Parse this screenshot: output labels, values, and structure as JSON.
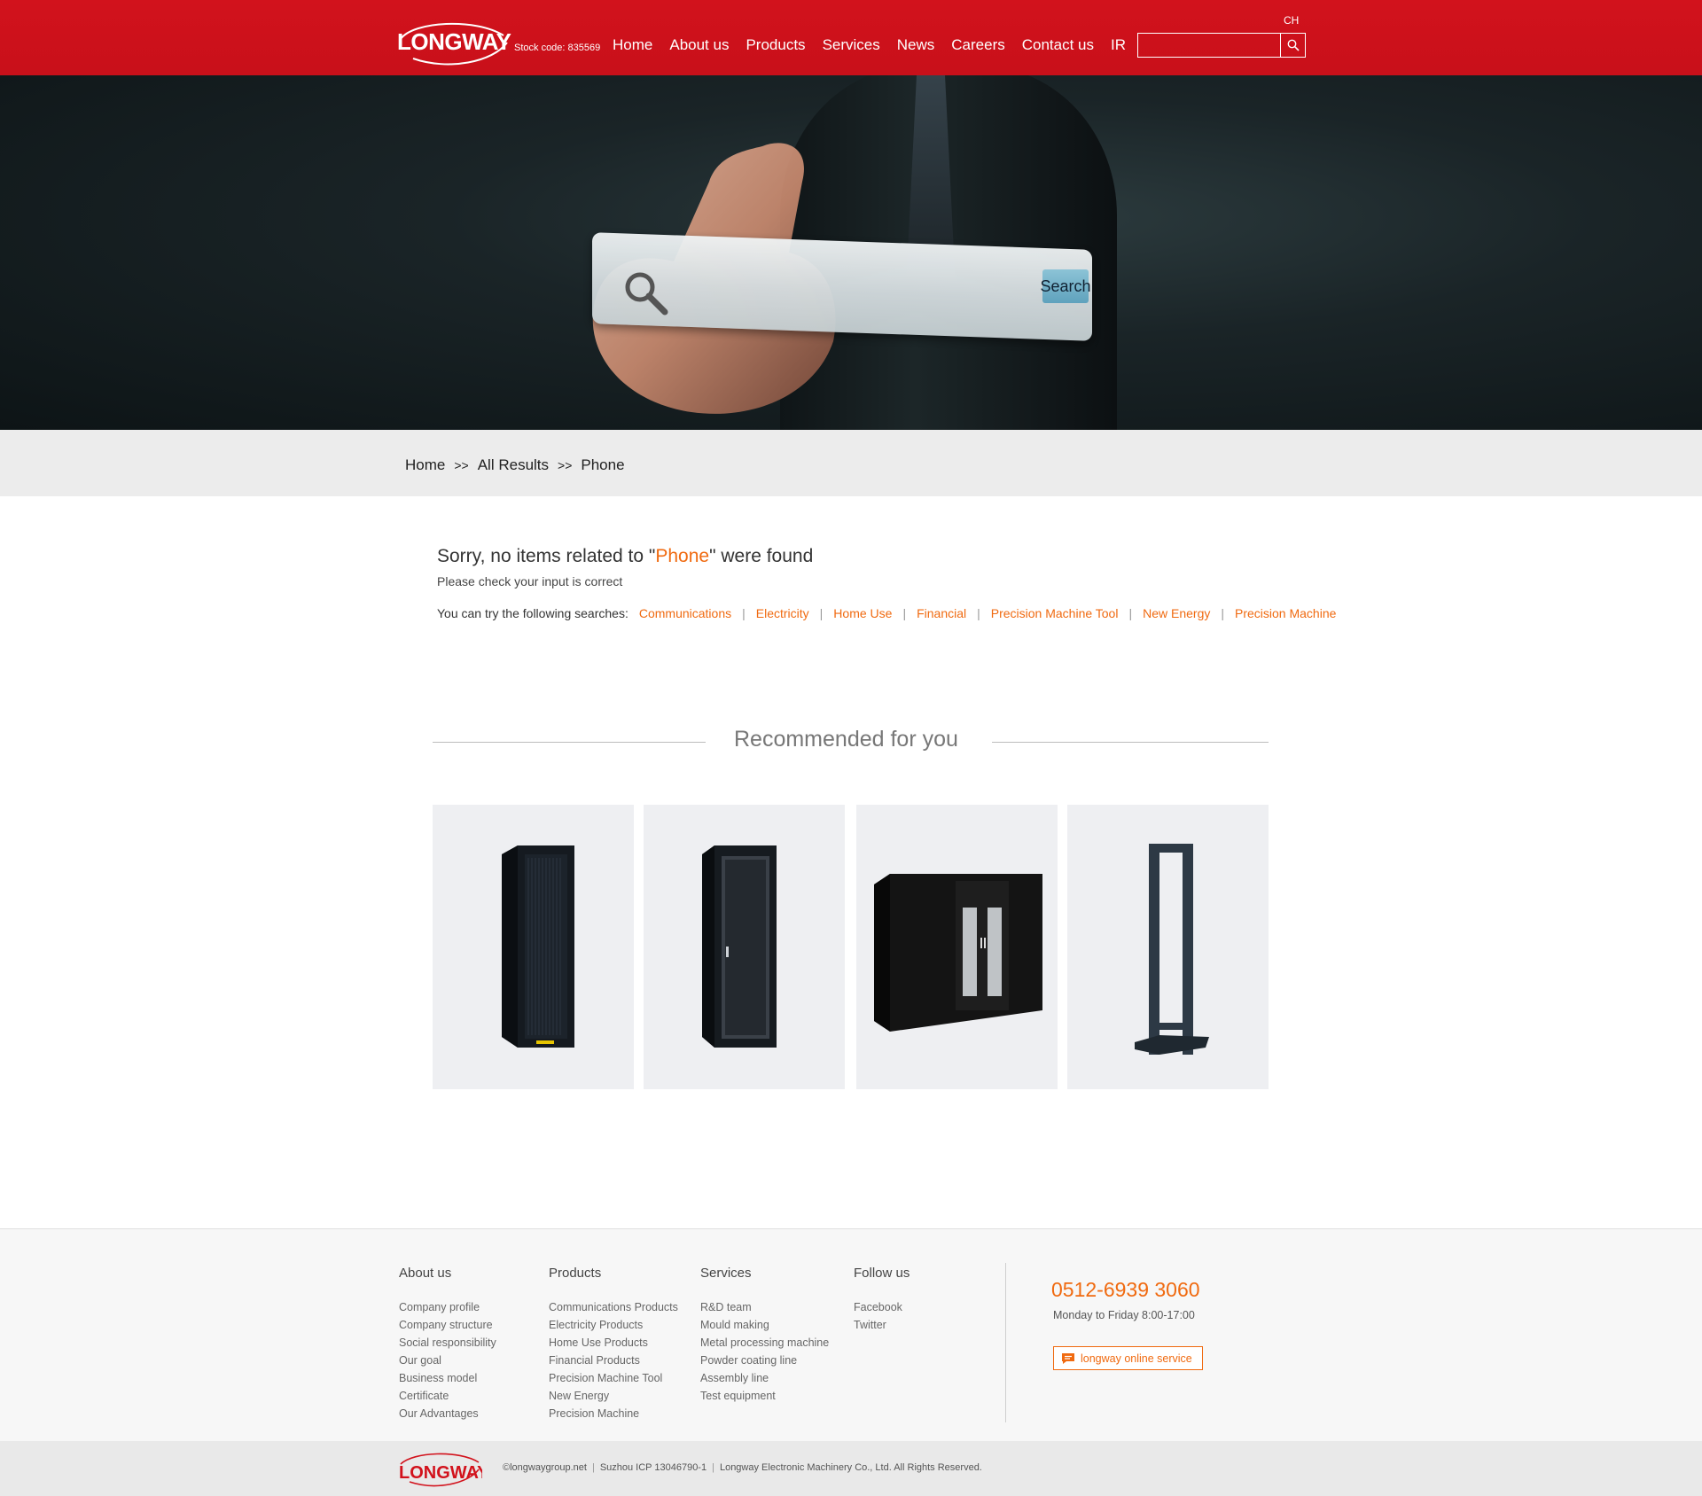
{
  "header": {
    "logo": "LONGWAY",
    "stock_code": "Stock code: 835569",
    "nav": [
      "Home",
      "About us",
      "Products",
      "Services",
      "News",
      "Careers",
      "Contact us",
      "IR"
    ],
    "lang": "CH",
    "search_value": ""
  },
  "banner": {
    "search_button": "Search"
  },
  "breadcrumb": {
    "items": [
      "Home",
      "All Results",
      "Phone"
    ],
    "separator": ">>"
  },
  "noresult": {
    "prefix": "Sorry, no items related to \"",
    "keyword": "Phone",
    "suffix": "\" were found",
    "hint": "Please check your input is correct",
    "try_label": "You can try the following searches:",
    "suggestions": [
      "Communications",
      "Electricity",
      "Home Use",
      "Financial",
      "Precision Machine Tool",
      "New Energy",
      "Precision Machine"
    ]
  },
  "recommended": {
    "title": "Recommended for you"
  },
  "footer": {
    "columns": [
      {
        "title": "About us",
        "links": [
          "Company profile",
          "Company structure",
          "Social responsibility",
          "Our goal",
          "Business model",
          "Certificate",
          "Our Advantages"
        ]
      },
      {
        "title": "Products",
        "links": [
          "Communications Products",
          "Electricity Products",
          "Home Use Products",
          "Financial Products",
          "Precision Machine Tool",
          "New Energy",
          "Precision Machine"
        ]
      },
      {
        "title": "Services",
        "links": [
          "R&D team",
          "Mould making",
          "Metal processing machine",
          "Powder coating line",
          "Assembly line",
          "Test equipment"
        ]
      },
      {
        "title": "Follow us",
        "links": [
          "Facebook",
          "Twitter"
        ]
      }
    ],
    "phone": "0512-6939 3060",
    "hours": "Monday to Friday 8:00-17:00",
    "online_service": "longway online service"
  },
  "bottom": {
    "logo": "LONGWAY",
    "site": "©longwaygroup.net",
    "icp": "Suzhou ICP 13046790-1",
    "rights": "Longway Electronic Machinery Co., Ltd. All Rights Reserved."
  },
  "colors": {
    "brand_red": "#d2121c",
    "accent_orange": "#f06a10"
  }
}
